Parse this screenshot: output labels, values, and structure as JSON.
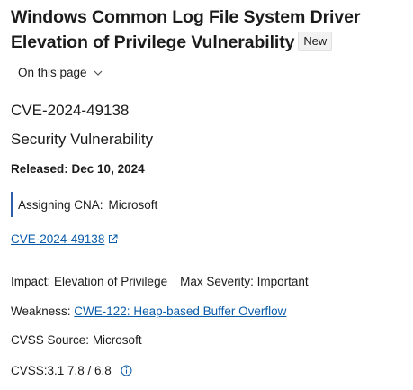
{
  "title": "Windows Common Log File System Driver Elevation of Privilege Vulnerability",
  "badge": "New",
  "on_this_page": "On this page",
  "cve_id": "CVE-2024-49138",
  "security_vulnerability": "Security Vulnerability",
  "released": "Released: Dec 10, 2024",
  "assigning_cna": {
    "label": "Assigning CNA:",
    "value": "Microsoft"
  },
  "cve_link": "CVE-2024-49138",
  "impact": {
    "text": "Impact: Elevation of Privilege",
    "max_severity": "Max Severity: Important"
  },
  "weakness": {
    "label": "Weakness:",
    "link": "CWE-122: Heap-based Buffer Overflow"
  },
  "cvss_source": {
    "label": "CVSS Source:",
    "value": "Microsoft"
  },
  "cvss": "CVSS:3.1 7.8 / 6.8",
  "colors": {
    "link": "#0a5ba8",
    "accent_bar": "#2f5da8",
    "text": "#1b1b1b"
  },
  "icons": [
    "chevron-down-icon",
    "external-link-icon",
    "info-icon"
  ]
}
